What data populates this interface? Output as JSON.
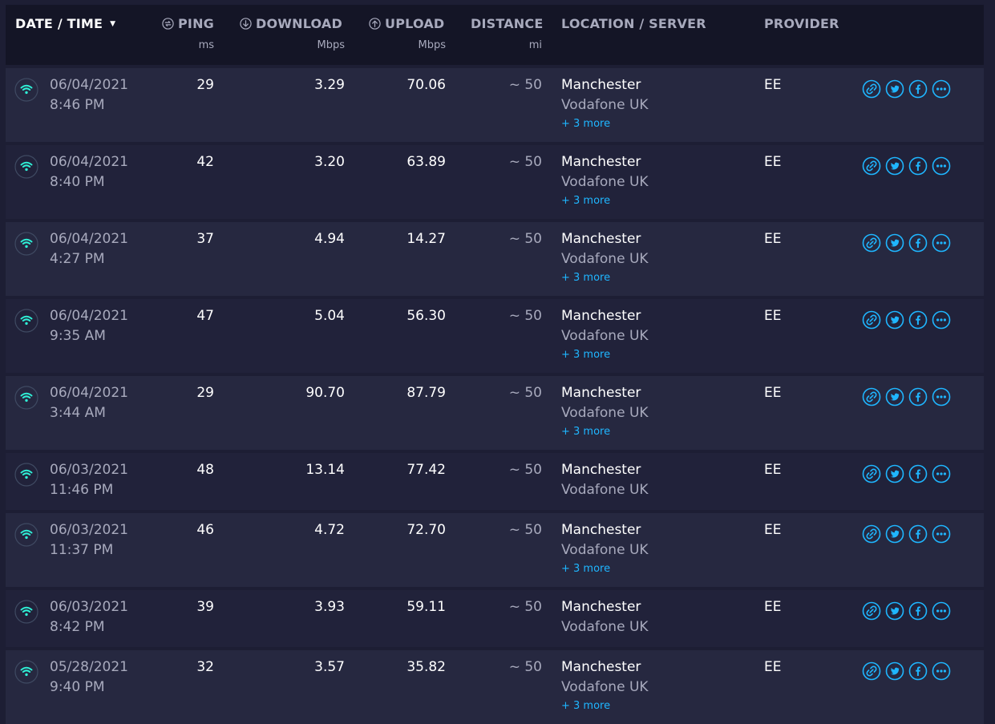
{
  "header": {
    "date": "DATE / TIME",
    "ping": "PING",
    "ping_unit": "ms",
    "download": "DOWNLOAD",
    "download_unit": "Mbps",
    "upload": "UPLOAD",
    "upload_unit": "Mbps",
    "distance": "DISTANCE",
    "distance_unit": "mi",
    "location": "LOCATION / SERVER",
    "provider": "PROVIDER"
  },
  "colors": {
    "accent": "#1fb6ff",
    "wifi": "#2ff0d6",
    "background": "#1d1e34",
    "header_bg": "#141526",
    "muted_text": "#a8aabd"
  },
  "icons": {
    "connection": "wifi-icon",
    "ping": "ping-icon",
    "download": "download-icon",
    "upload": "upload-icon",
    "share_link": "link-icon",
    "share_twitter": "twitter-icon",
    "share_facebook": "facebook-icon",
    "more": "more-icon"
  },
  "rows": [
    {
      "date": "06/04/2021",
      "time": "8:46 PM",
      "ping": "29",
      "download": "3.29",
      "upload": "70.06",
      "distance": "~ 50",
      "city": "Manchester",
      "server": "Vodafone UK",
      "more": "+ 3 more",
      "provider": "EE"
    },
    {
      "date": "06/04/2021",
      "time": "8:40 PM",
      "ping": "42",
      "download": "3.20",
      "upload": "63.89",
      "distance": "~ 50",
      "city": "Manchester",
      "server": "Vodafone UK",
      "more": "+ 3 more",
      "provider": "EE"
    },
    {
      "date": "06/04/2021",
      "time": "4:27 PM",
      "ping": "37",
      "download": "4.94",
      "upload": "14.27",
      "distance": "~ 50",
      "city": "Manchester",
      "server": "Vodafone UK",
      "more": "+ 3 more",
      "provider": "EE"
    },
    {
      "date": "06/04/2021",
      "time": "9:35 AM",
      "ping": "47",
      "download": "5.04",
      "upload": "56.30",
      "distance": "~ 50",
      "city": "Manchester",
      "server": "Vodafone UK",
      "more": "+ 3 more",
      "provider": "EE"
    },
    {
      "date": "06/04/2021",
      "time": "3:44 AM",
      "ping": "29",
      "download": "90.70",
      "upload": "87.79",
      "distance": "~ 50",
      "city": "Manchester",
      "server": "Vodafone UK",
      "more": "+ 3 more",
      "provider": "EE"
    },
    {
      "date": "06/03/2021",
      "time": "11:46 PM",
      "ping": "48",
      "download": "13.14",
      "upload": "77.42",
      "distance": "~ 50",
      "city": "Manchester",
      "server": "Vodafone UK",
      "more": "",
      "provider": "EE"
    },
    {
      "date": "06/03/2021",
      "time": "11:37 PM",
      "ping": "46",
      "download": "4.72",
      "upload": "72.70",
      "distance": "~ 50",
      "city": "Manchester",
      "server": "Vodafone UK",
      "more": "+ 3 more",
      "provider": "EE"
    },
    {
      "date": "06/03/2021",
      "time": "8:42 PM",
      "ping": "39",
      "download": "3.93",
      "upload": "59.11",
      "distance": "~ 50",
      "city": "Manchester",
      "server": "Vodafone UK",
      "more": "",
      "provider": "EE"
    },
    {
      "date": "05/28/2021",
      "time": "9:40 PM",
      "ping": "32",
      "download": "3.57",
      "upload": "35.82",
      "distance": "~ 50",
      "city": "Manchester",
      "server": "Vodafone UK",
      "more": "+ 3 more",
      "provider": "EE"
    }
  ]
}
